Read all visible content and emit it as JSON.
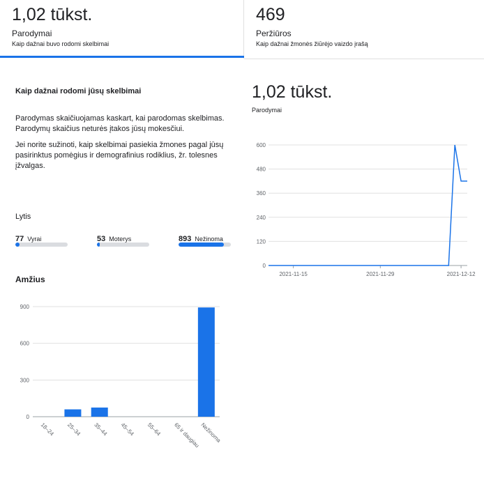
{
  "tabs": [
    {
      "value": "1,02 tūkst.",
      "label": "Parodymai",
      "desc": "Kaip dažnai buvo rodomi skelbimai"
    },
    {
      "value": "469",
      "label": "Peržiūros",
      "desc": "Kaip dažnai žmonės žiūrėjo vaizdo įrašą"
    }
  ],
  "info": {
    "title": "Kaip dažnai rodomi jūsų skelbimai",
    "p1": "Parodymas skaičiuojamas kaskart, kai parodomas skelbimas. Parodymų skaičius neturės įtakos jūsų mokesčiui.",
    "p2": "Jei norite sužinoti, kaip skelbimai pasiekia žmones pagal jūsų pasirinktus pomėgius ir demografinius rodiklius, žr. tolesnes įžvalgas."
  },
  "gender": {
    "title": "Lytis",
    "items": [
      {
        "value": "77",
        "label": "Vyrai",
        "fraction": 0.075
      },
      {
        "value": "53",
        "label": "Moterys",
        "fraction": 0.052
      },
      {
        "value": "893",
        "label": "Nežinoma",
        "fraction": 0.873
      }
    ]
  },
  "age": {
    "title": "Amžius"
  },
  "summary": {
    "value": "1,02 tūkst.",
    "label": "Parodymai"
  },
  "colors": {
    "accent": "#1a73e8",
    "track": "#dadce0",
    "grid": "#e0e0e0"
  },
  "chart_data": [
    {
      "type": "line",
      "x": [
        "2021-11-11",
        "2021-11-12",
        "2021-11-13",
        "2021-11-14",
        "2021-11-15",
        "2021-11-16",
        "2021-11-17",
        "2021-11-18",
        "2021-11-19",
        "2021-11-20",
        "2021-11-21",
        "2021-11-22",
        "2021-11-23",
        "2021-11-24",
        "2021-11-25",
        "2021-11-26",
        "2021-11-27",
        "2021-11-28",
        "2021-11-29",
        "2021-11-30",
        "2021-12-01",
        "2021-12-02",
        "2021-12-03",
        "2021-12-04",
        "2021-12-05",
        "2021-12-06",
        "2021-12-07",
        "2021-12-08",
        "2021-12-09",
        "2021-12-10",
        "2021-12-11",
        "2021-12-12",
        "2021-12-13"
      ],
      "values": [
        0,
        0,
        0,
        0,
        0,
        0,
        0,
        0,
        0,
        0,
        0,
        0,
        0,
        0,
        0,
        0,
        0,
        0,
        0,
        0,
        0,
        0,
        0,
        0,
        0,
        0,
        0,
        0,
        0,
        0,
        600,
        420,
        420
      ],
      "x_ticks": [
        "2021-11-15",
        "2021-11-29",
        "2021-12-12"
      ],
      "y_ticks": [
        "0",
        "120",
        "240",
        "360",
        "480",
        "600"
      ],
      "ylim": [
        0,
        600
      ]
    },
    {
      "type": "bar",
      "categories": [
        "18–24",
        "25–34",
        "35–44",
        "45–54",
        "55–64",
        "65 ir daugiau",
        "Nežinoma"
      ],
      "values": [
        0,
        60,
        75,
        0,
        0,
        0,
        893
      ],
      "y_ticks": [
        "0",
        "300",
        "600",
        "900"
      ],
      "ylim": [
        0,
        900
      ]
    }
  ]
}
